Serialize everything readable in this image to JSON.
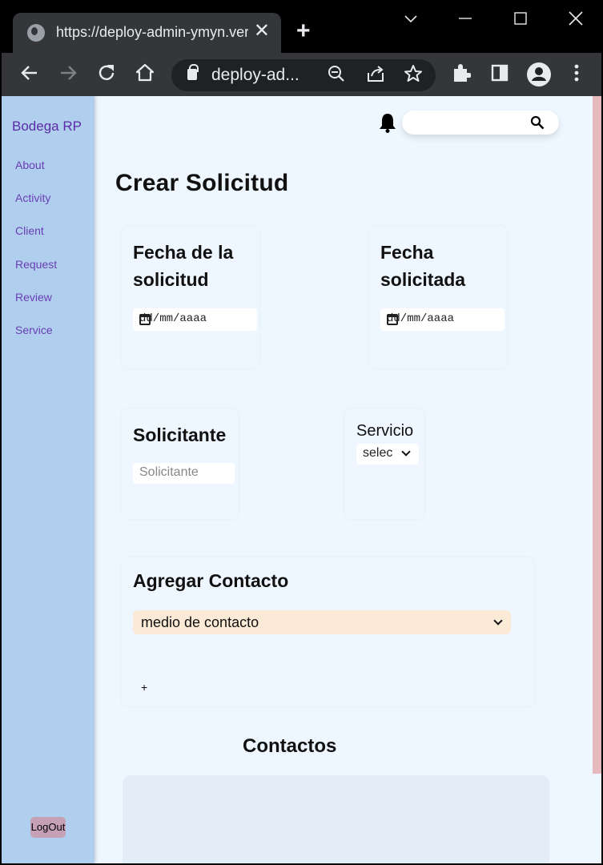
{
  "browser": {
    "tab_title": "https://deploy-admin-ymyn.vercel.app",
    "address_text": "deploy-ad...",
    "new_tab_label": "+",
    "close_tab_label": "✕"
  },
  "sidebar": {
    "brand": "Bodega RP",
    "items": [
      {
        "label": "About"
      },
      {
        "label": "Activity"
      },
      {
        "label": "Client"
      },
      {
        "label": "Request"
      },
      {
        "label": "Review"
      },
      {
        "label": "Service"
      }
    ],
    "logout_label": "LogOut"
  },
  "header": {
    "search_value": "",
    "search_icon": "search-icon",
    "bell_icon": "bell-icon"
  },
  "main": {
    "title": "Crear Solicitud",
    "fecha_solicitud_label": "Fecha de la solicitud",
    "fecha_solicitud_value": "dd/mm/aaaa",
    "fecha_solicitada_label": "Fecha solicitada",
    "fecha_solicitada_value": "dd/mm/aaaa",
    "solicitante_label": "Solicitante",
    "solicitante_placeholder": "Solicitante",
    "servicio_label": "Servicio",
    "servicio_selected": "selecciona",
    "agregar_contacto_label": "Agregar Contacto",
    "medio_contacto_selected": "medio de contacto",
    "add_button_label": "+",
    "contactos_label": "Contactos"
  },
  "colors": {
    "sidebar_bg": "#b0cfee",
    "brand": "#5b2aa8",
    "page_bg": "#eef6ff",
    "contact_select_bg": "#fbead6",
    "logout_bg": "#c6a1b5",
    "scrollbar": "#e6b9be"
  }
}
